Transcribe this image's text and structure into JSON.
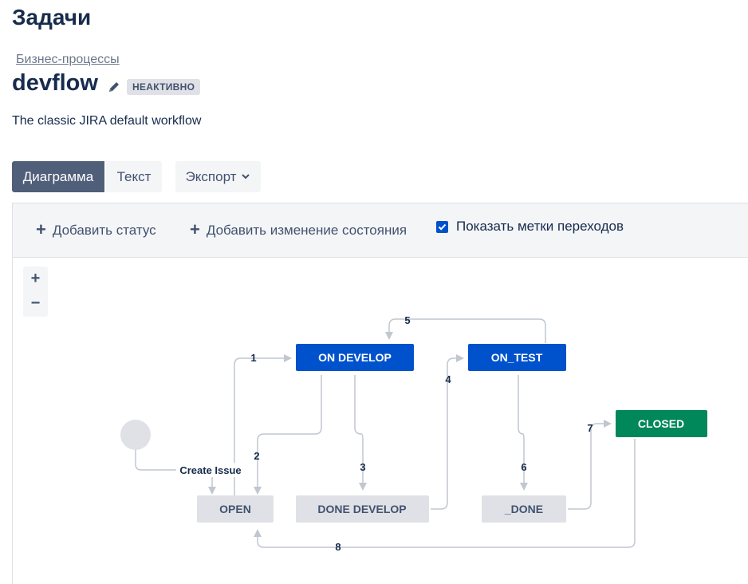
{
  "header": {
    "title": "Задачи",
    "breadcrumb": "Бизнес-процессы",
    "workflow_name": "devflow",
    "status_badge": "НЕАКТИВНО",
    "description": "The classic JIRA default workflow"
  },
  "tabs": {
    "diagram": "Диаграмма",
    "text": "Текст",
    "export": "Экспорт"
  },
  "toolbar": {
    "add_status": "Добавить статус",
    "add_transition": "Добавить изменение состояния",
    "show_labels": "Показать метки переходов",
    "show_labels_checked": true
  },
  "zoom": {
    "in": "+",
    "out": "−"
  },
  "diagram": {
    "statuses": {
      "on_develop": "ON DEVELOP",
      "on_test": "ON_TEST",
      "closed": "CLOSED",
      "open": "OPEN",
      "done_develop": "DONE DEVELOP",
      "done": "_DONE"
    },
    "transitions": {
      "create": "Create Issue",
      "t1": "1",
      "t2": "2",
      "t3": "3",
      "t4": "4",
      "t5": "5",
      "t6": "6",
      "t7": "7",
      "t8": "8"
    },
    "colors": {
      "in_progress": "#0052cc",
      "done": "#00875a",
      "todo": "#dfe1e6",
      "line": "#c1c7d0"
    }
  }
}
